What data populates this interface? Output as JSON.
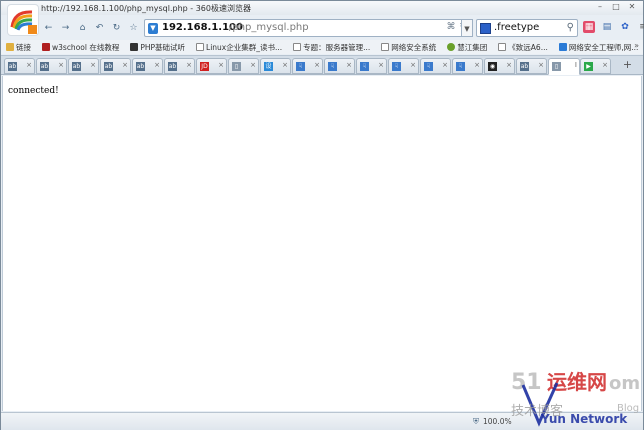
{
  "window": {
    "title": "http://192.168.1.100/php_mysql.php - 360极速浏览器"
  },
  "nav": {
    "back": "←",
    "forward": "→",
    "home": "⌂",
    "undo": "↶",
    "refresh": "↻",
    "favorite": "☆"
  },
  "address": {
    "host": "192.168.1.100",
    "path": "/php_mysql.php"
  },
  "search": {
    "value": ".freetype"
  },
  "bookmarks": [
    {
      "label": "链接",
      "color": "#e0b040"
    },
    {
      "label": "w3school 在线教程",
      "color": "#b02020"
    },
    {
      "label": "PHP基础试听",
      "color": "#333333"
    },
    {
      "label": "Linux企业集群_读书...",
      "color": "#888888"
    },
    {
      "label": "专题：服务器管理...",
      "color": "#888888"
    },
    {
      "label": "网络安全系统",
      "color": "#888888"
    },
    {
      "label": "慧江集团",
      "color": "#6aa02a"
    },
    {
      "label": "《致远A6...",
      "color": "#888888"
    },
    {
      "label": "网络安全工程师,网...",
      "color": "#2b7bd6"
    }
  ],
  "tabs": [
    {
      "fav": "ab",
      "text": "×",
      "color": "#55708c"
    },
    {
      "fav": "ab",
      "text": "×",
      "color": "#55708c"
    },
    {
      "fav": "ab",
      "text": "×",
      "color": "#55708c"
    },
    {
      "fav": "ab",
      "text": "×",
      "color": "#55708c"
    },
    {
      "fav": "ab",
      "text": "×",
      "color": "#55708c"
    },
    {
      "fav": "ab",
      "text": "×",
      "color": "#55708c"
    },
    {
      "fav": "JD",
      "text": "×",
      "color": "#d02020"
    },
    {
      "fav": "▯",
      "text": "×",
      "color": "#8899aa"
    },
    {
      "fav": "设",
      "text": "×",
      "color": "#2a8ad8"
    },
    {
      "fav": "☟",
      "text": "×",
      "color": "#3a7acc"
    },
    {
      "fav": "☟",
      "text": "×",
      "color": "#3a7acc"
    },
    {
      "fav": "☟",
      "text": "×",
      "color": "#3a7acc"
    },
    {
      "fav": "☟",
      "text": "×",
      "color": "#3a7acc"
    },
    {
      "fav": "☟",
      "text": "×",
      "color": "#3a7acc"
    },
    {
      "fav": "☟",
      "text": "×",
      "color": "#3a7acc"
    },
    {
      "fav": "◉",
      "text": "×",
      "color": "#222222"
    },
    {
      "fav": "ab",
      "text": "×",
      "color": "#55708c"
    },
    {
      "fav": "▯",
      "text": "I",
      "color": "#8899aa",
      "active": true
    },
    {
      "fav": "▶",
      "text": "×",
      "color": "#2aa84a"
    }
  ],
  "content": {
    "message": "connected!"
  },
  "status": {
    "zoom": "100.0%"
  },
  "colors": {
    "accent": "#2d7dd2",
    "frame": "#7a8a99"
  }
}
